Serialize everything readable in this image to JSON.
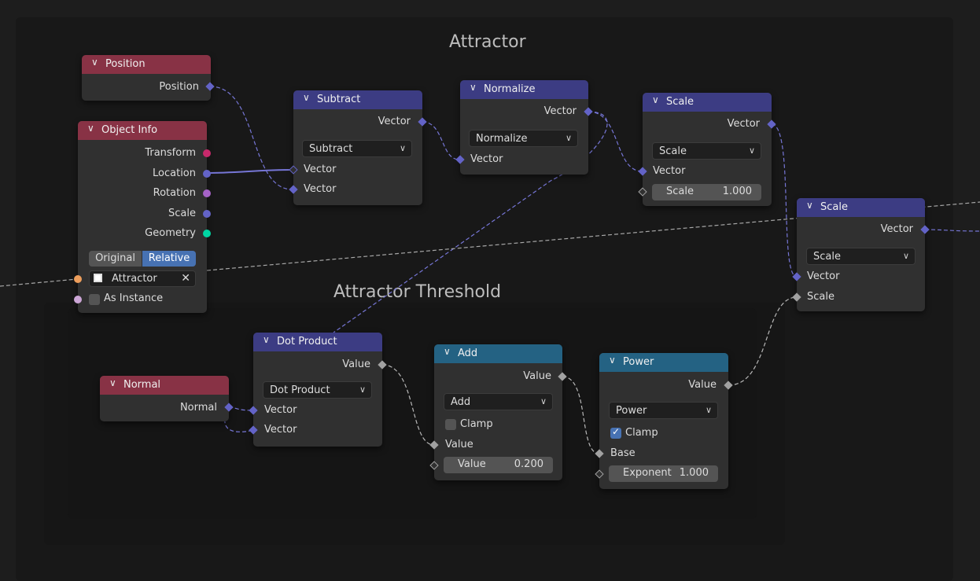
{
  "frames": {
    "attractor": "Attractor",
    "threshold": "Attractor Threshold"
  },
  "nodes": {
    "position": {
      "title": "Position",
      "outputs": [
        "Position"
      ]
    },
    "object_info": {
      "title": "Object Info",
      "outputs": [
        "Transform",
        "Location",
        "Rotation",
        "Scale",
        "Geometry"
      ],
      "toggle": [
        "Original",
        "Relative"
      ],
      "object": "Attractor",
      "as_instance": "As Instance"
    },
    "subtract": {
      "title": "Subtract",
      "output": "Vector",
      "mode": "Subtract",
      "inputs": [
        "Vector",
        "Vector"
      ]
    },
    "normalize": {
      "title": "Normalize",
      "output": "Vector",
      "mode": "Normalize",
      "input": "Vector"
    },
    "scale1": {
      "title": "Scale",
      "output": "Vector",
      "mode": "Scale",
      "input": "Vector",
      "field_label": "Scale",
      "field_value": "1.000"
    },
    "scale2": {
      "title": "Scale",
      "output": "Vector",
      "mode": "Scale",
      "inputs": [
        "Vector",
        "Scale"
      ]
    },
    "normal": {
      "title": "Normal",
      "output": "Normal"
    },
    "dot": {
      "title": "Dot Product",
      "output": "Value",
      "mode": "Dot Product",
      "inputs": [
        "Vector",
        "Vector"
      ]
    },
    "add": {
      "title": "Add",
      "output": "Value",
      "mode": "Add",
      "clamp": "Clamp",
      "input": "Value",
      "field_label": "Value",
      "field_value": "0.200"
    },
    "power": {
      "title": "Power",
      "output": "Value",
      "mode": "Power",
      "clamp": "Clamp",
      "base": "Base",
      "field_label": "Exponent",
      "field_value": "1.000"
    }
  },
  "colors": {
    "geometry_header": "#883245",
    "vector_header": "#3c3c83",
    "math_header": "#246283",
    "vector_socket": "#6363c7",
    "float_socket": "#a1a1a1",
    "geometry_socket": "#00d6a3",
    "rotation_socket": "#a663c7",
    "matrix_socket": "#c7296b",
    "object_socket": "#ed9e5c",
    "bool_socket": "#cca6d6",
    "toggle_active": "#4772b3"
  }
}
